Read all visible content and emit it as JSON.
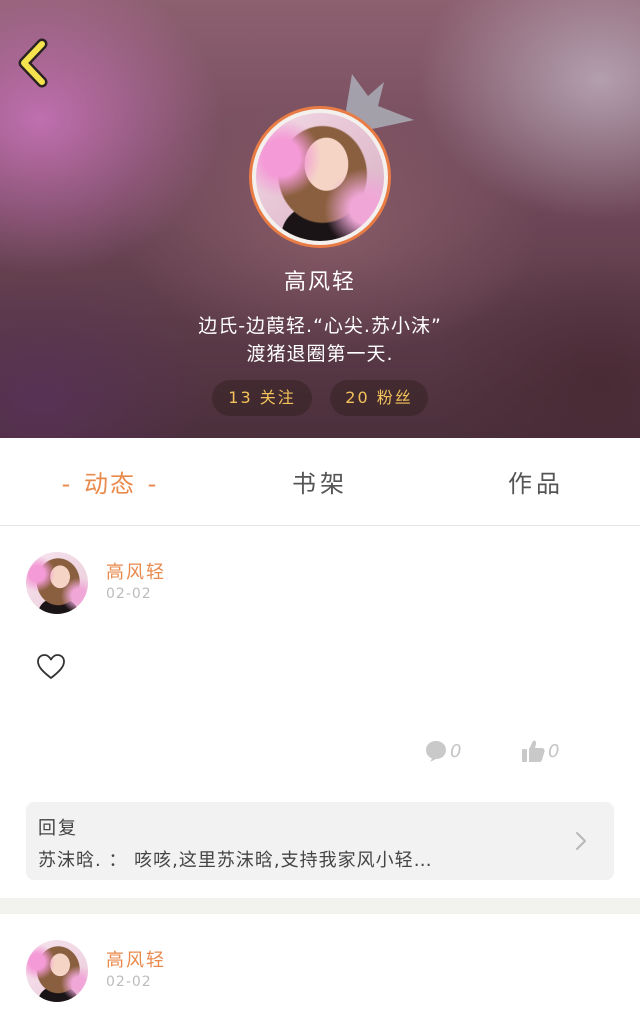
{
  "header": {
    "name": "高风轻",
    "bio_line1": "边氏-边葭轻.“心尖.苏小沫”",
    "bio_line2": "渡猪退圈第一天.",
    "following": "13 关注",
    "fans": "20 粉丝"
  },
  "tabs": {
    "dynamics_label": "动态",
    "shelf_label": "书架",
    "works_label": "作品",
    "active": "dynamics"
  },
  "posts": [
    {
      "author": "高风轻",
      "date": "02-02",
      "comment_count": "0",
      "like_count": "0",
      "reply": {
        "title": "回复",
        "text": "苏沫晗. ： 咳咳,这里苏沫晗,支持我家风小轻…"
      }
    },
    {
      "author": "高风轻",
      "date": "02-02"
    }
  ],
  "colors": {
    "accent": "#e98a4d",
    "stat_text": "#f3c25a",
    "muted": "#bcbcbc"
  },
  "icons": [
    "chevron-left-icon",
    "crown-icon",
    "heart-icon",
    "comment-icon",
    "thumbs-up-icon",
    "chevron-right-icon"
  ]
}
